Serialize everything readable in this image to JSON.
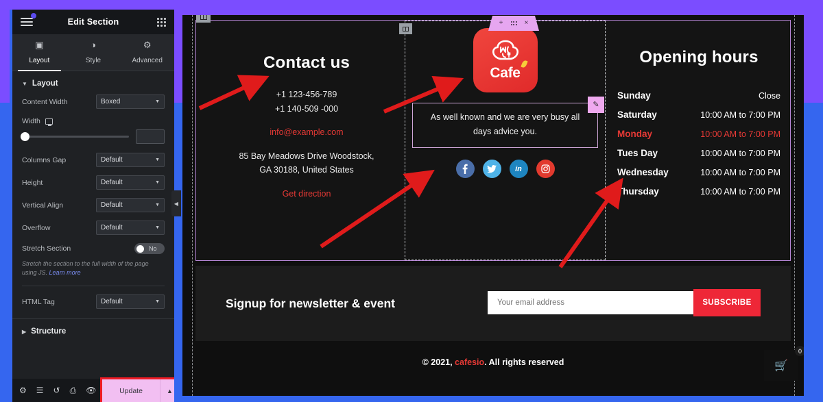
{
  "panel": {
    "title": "Edit Section",
    "menu_icon": "hamburger-icon",
    "apps_icon": "apps-grid-icon",
    "tabs": [
      {
        "label": "Layout",
        "icon": "columns-icon"
      },
      {
        "label": "Style",
        "icon": "contrast-icon"
      },
      {
        "label": "Advanced",
        "icon": "gear-icon"
      }
    ],
    "section_label": "Layout",
    "controls": [
      {
        "label": "Content Width",
        "value": "Boxed"
      },
      {
        "label": "Columns Gap",
        "value": "Default"
      },
      {
        "label": "Height",
        "value": "Default"
      },
      {
        "label": "Vertical Align",
        "value": "Default"
      },
      {
        "label": "Overflow",
        "value": "Default"
      }
    ],
    "width": {
      "label": "Width",
      "device_icon": "monitor-icon",
      "value": ""
    },
    "stretch": {
      "label": "Stretch Section",
      "state": "No"
    },
    "helper": "Stretch the section to the full width of the page using JS.",
    "helper_link": "Learn more",
    "html_tag": {
      "label": "HTML Tag",
      "value": "Default"
    },
    "structure_label": "Structure",
    "footer_icons": [
      "settings-gear-icon",
      "layers-icon",
      "history-icon",
      "responsive-icon",
      "preview-eye-icon"
    ],
    "update_label": "Update",
    "update_arrow": "chevron-up-icon"
  },
  "canvas": {
    "section_handle_icon": "column-handle-icon",
    "float_tools": {
      "add": "+",
      "drag": "drag-grid-icon",
      "close": "×"
    },
    "contact": {
      "title": "Contact us",
      "phone1": "+1 123-456-789",
      "phone2": "+1 140-509 -000",
      "email": "info@example.com",
      "address_line1": "85 Bay Meadows Drive Woodstock,",
      "address_line2": "GA 30188, United States",
      "get_direction": "Get direction"
    },
    "middle": {
      "handle_icon": "column-handle-icon",
      "logo_word": "Cafe",
      "logo_mark": "chef-hat-monogram-icon",
      "quote": "As well known and we are very busy all days advice you.",
      "edit_badge_icon": "pencil-icon",
      "socials": [
        {
          "name": "facebook-icon",
          "glyph": "f",
          "color": "#4a6ea9"
        },
        {
          "name": "twitter-icon",
          "glyph": "t",
          "color": "#4fb3e8"
        },
        {
          "name": "linkedin-icon",
          "glyph": "in",
          "color": "#1e85c0"
        },
        {
          "name": "instagram-icon",
          "glyph": "◉",
          "color": "#e23a2e"
        }
      ]
    },
    "hours": {
      "title": "Opening hours",
      "rows": [
        {
          "day": "Sunday",
          "time": "Close",
          "active": false
        },
        {
          "day": "Saturday",
          "time": "10:00 AM to 7:00 PM",
          "active": false
        },
        {
          "day": "Monday",
          "time": "10:00 AM to 7:00 PM",
          "active": true
        },
        {
          "day": "Tues Day",
          "time": "10:00 AM to 7:00 PM",
          "active": false
        },
        {
          "day": "Wednesday",
          "time": "10:00 AM to 7:00 PM",
          "active": false
        },
        {
          "day": "Thursday",
          "time": "10:00 AM to 7:00 PM",
          "active": false
        }
      ]
    },
    "newsletter": {
      "title": "Signup for newsletter & event",
      "placeholder": "Your email address",
      "value": "",
      "button": "SUBSCRIBE"
    },
    "copyright": {
      "prefix": "© 2021, ",
      "brand": "cafesio",
      "suffix": ". All rights reserved"
    },
    "cart": {
      "icon": "shopping-cart-icon",
      "count": "0"
    },
    "collapse_icon": "chevron-left-icon"
  },
  "colors": {
    "accent_red": "#e53935",
    "subscribe_red": "#ee2737",
    "frame_purple": "#7b4dff",
    "frame_blue": "#3566ef",
    "update_pink": "#f2bff2",
    "highlight_red": "#ef1b24",
    "selection_purple": "#b887d8"
  },
  "annotations": {
    "arrow_color": "#e01b1b",
    "arrows": [
      {
        "name": "arrow-to-contact-phone"
      },
      {
        "name": "arrow-to-logo"
      },
      {
        "name": "arrow-to-social-icons"
      },
      {
        "name": "arrow-to-opening-hours"
      }
    ]
  }
}
